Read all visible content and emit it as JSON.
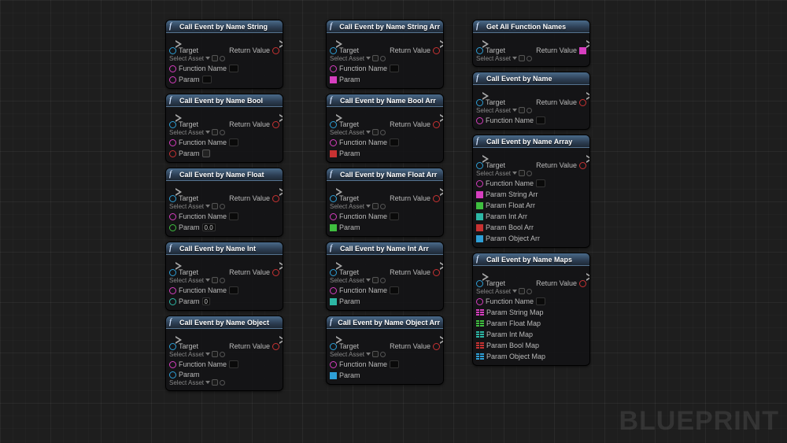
{
  "watermark": "BLUEPRINT",
  "common": {
    "target": "Target",
    "select_asset": "Select Asset",
    "return_value": "Return Value",
    "function_name": "Function Name",
    "param": "Param",
    "zero": "0",
    "zero_float": "0.0"
  },
  "columns": [
    {
      "nodes": [
        {
          "title": "Call Event by Name String",
          "param_type": "textbox",
          "param_value": ""
        },
        {
          "title": "Call Event by Name Bool",
          "param_type": "checkbox"
        },
        {
          "title": "Call Event by Name Float",
          "param_type": "textbox",
          "param_value": "0.0",
          "param_pin": "green"
        },
        {
          "title": "Call Event by Name Int",
          "param_type": "textbox",
          "param_value": "0",
          "param_pin": "teal"
        },
        {
          "title": "Call Event by Name Object",
          "param_type": "asset"
        }
      ]
    },
    {
      "nodes": [
        {
          "title": "Call Event by Name String Arr",
          "arr_pin": "magenta"
        },
        {
          "title": "Call Event by Name Bool Arr",
          "arr_pin": "red"
        },
        {
          "title": "Call Event by Name Float Arr",
          "arr_pin": "green"
        },
        {
          "title": "Call Event by Name Int Arr",
          "arr_pin": "teal"
        },
        {
          "title": "Call Event by Name Object Arr",
          "arr_pin": "blue"
        }
      ]
    },
    {
      "nodes": [
        {
          "title": "Get All Function Names",
          "kind": "getnames"
        },
        {
          "title": "Call Event by Name",
          "kind": "noparam"
        },
        {
          "title": "Call Event by Name Array",
          "kind": "arraylist",
          "params": [
            {
              "label": "Param String Arr",
              "color": "magenta"
            },
            {
              "label": "Param Float Arr",
              "color": "green"
            },
            {
              "label": "Param Int Arr",
              "color": "teal"
            },
            {
              "label": "Param Bool Arr",
              "color": "red"
            },
            {
              "label": "Param Object Arr",
              "color": "blue"
            }
          ]
        },
        {
          "title": "Call Event by Name Maps",
          "kind": "maplist",
          "params": [
            {
              "label": "Param String Map",
              "color": "magenta"
            },
            {
              "label": "Param Float Map",
              "color": "green"
            },
            {
              "label": "Param Int Map",
              "color": "teal"
            },
            {
              "label": "Param Bool Map",
              "color": "red"
            },
            {
              "label": "Param Object Map",
              "color": "blue"
            }
          ]
        }
      ]
    }
  ]
}
